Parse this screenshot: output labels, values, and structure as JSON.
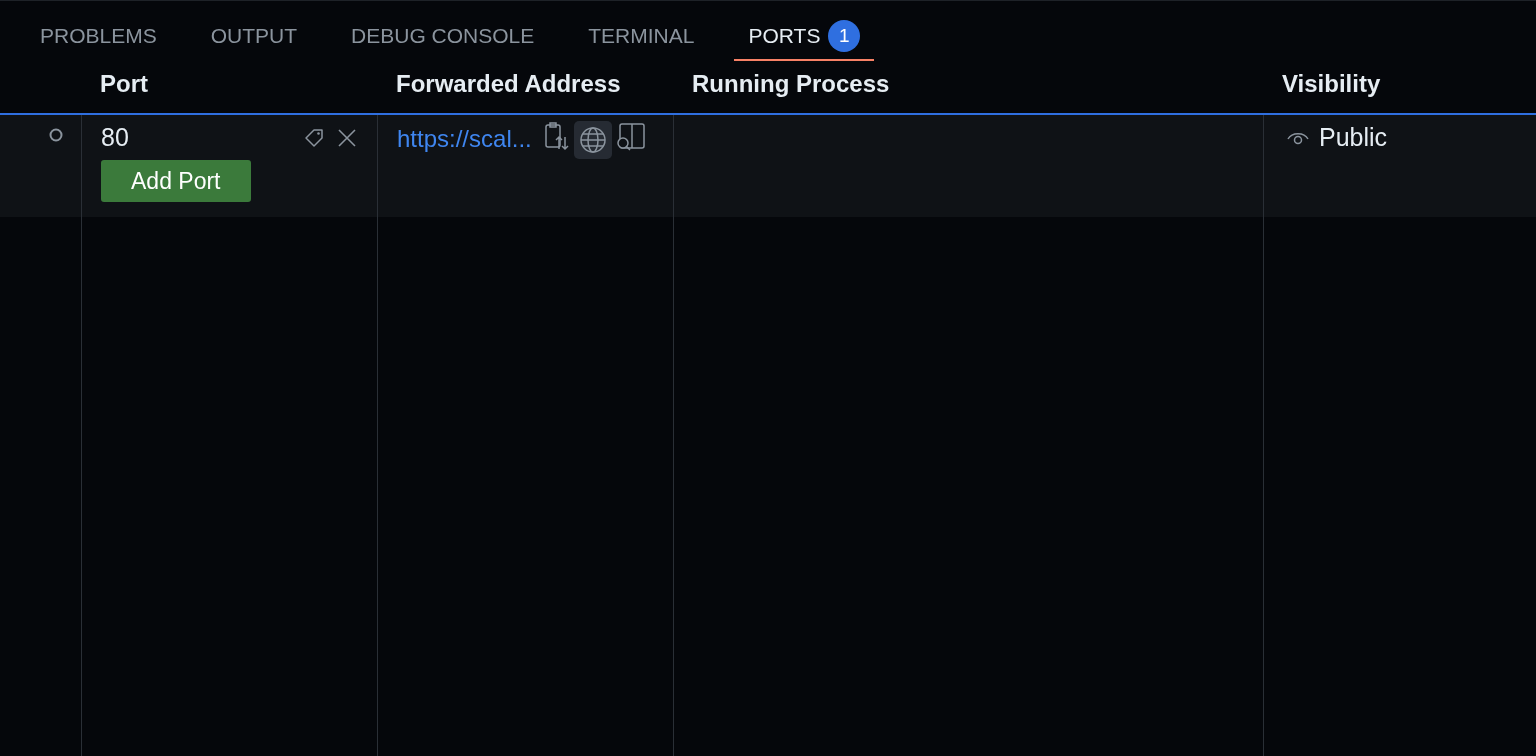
{
  "tabs": [
    {
      "label": "PROBLEMS",
      "selected": false
    },
    {
      "label": "OUTPUT",
      "selected": false
    },
    {
      "label": "DEBUG CONSOLE",
      "selected": false
    },
    {
      "label": "TERMINAL",
      "selected": false
    },
    {
      "label": "PORTS",
      "selected": true,
      "badge": "1"
    }
  ],
  "table": {
    "columns": [
      "Port",
      "Forwarded Address",
      "Running Process",
      "Visibility"
    ],
    "rows": [
      {
        "port": "80",
        "address": "https://scal...",
        "visibility": "Public"
      }
    ],
    "add_button": "Add Port"
  }
}
